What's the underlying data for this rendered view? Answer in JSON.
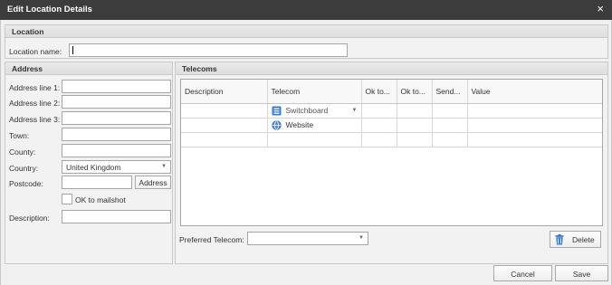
{
  "window": {
    "title": "Edit Location Details",
    "close_glyph": "×"
  },
  "location": {
    "header": "Location",
    "name_label": "Location name:",
    "name_value": ""
  },
  "address": {
    "header": "Address",
    "fields": [
      {
        "label": "Address line 1:",
        "value": ""
      },
      {
        "label": "Address line 2:",
        "value": ""
      },
      {
        "label": "Address line 3:",
        "value": ""
      },
      {
        "label": "Town:",
        "value": ""
      },
      {
        "label": "County:",
        "value": ""
      }
    ],
    "country_label": "Country:",
    "country_value": "United Kingdom",
    "postcode_label": "Postcode:",
    "postcode_value": "",
    "address_button": "Address",
    "mailshot_label": "OK to mailshot",
    "mailshot_checked": false,
    "description_label": "Description:",
    "description_value": ""
  },
  "telecoms": {
    "header": "Telecoms",
    "columns": [
      "Description",
      "Telecom",
      "Ok to...",
      "Ok to...",
      "Send...",
      "Value"
    ],
    "rows": [
      {
        "description": "",
        "telecom": "Switchboard",
        "icon": "switchboard-icon",
        "has_dropdown": true
      },
      {
        "description": "",
        "telecom": "Website",
        "icon": "globe-icon",
        "has_dropdown": false
      },
      {
        "description": "",
        "telecom": "",
        "icon": "",
        "has_dropdown": false
      }
    ],
    "preferred_label": "Preferred Telecom:",
    "preferred_value": "",
    "delete_button": "Delete"
  },
  "footer": {
    "cancel_button": "Cancel",
    "save_button": "Save"
  },
  "colors": {
    "titlebar": "#3c3c3c",
    "panel": "#f0f0f0",
    "icon_blue": "#3a7bd5"
  }
}
